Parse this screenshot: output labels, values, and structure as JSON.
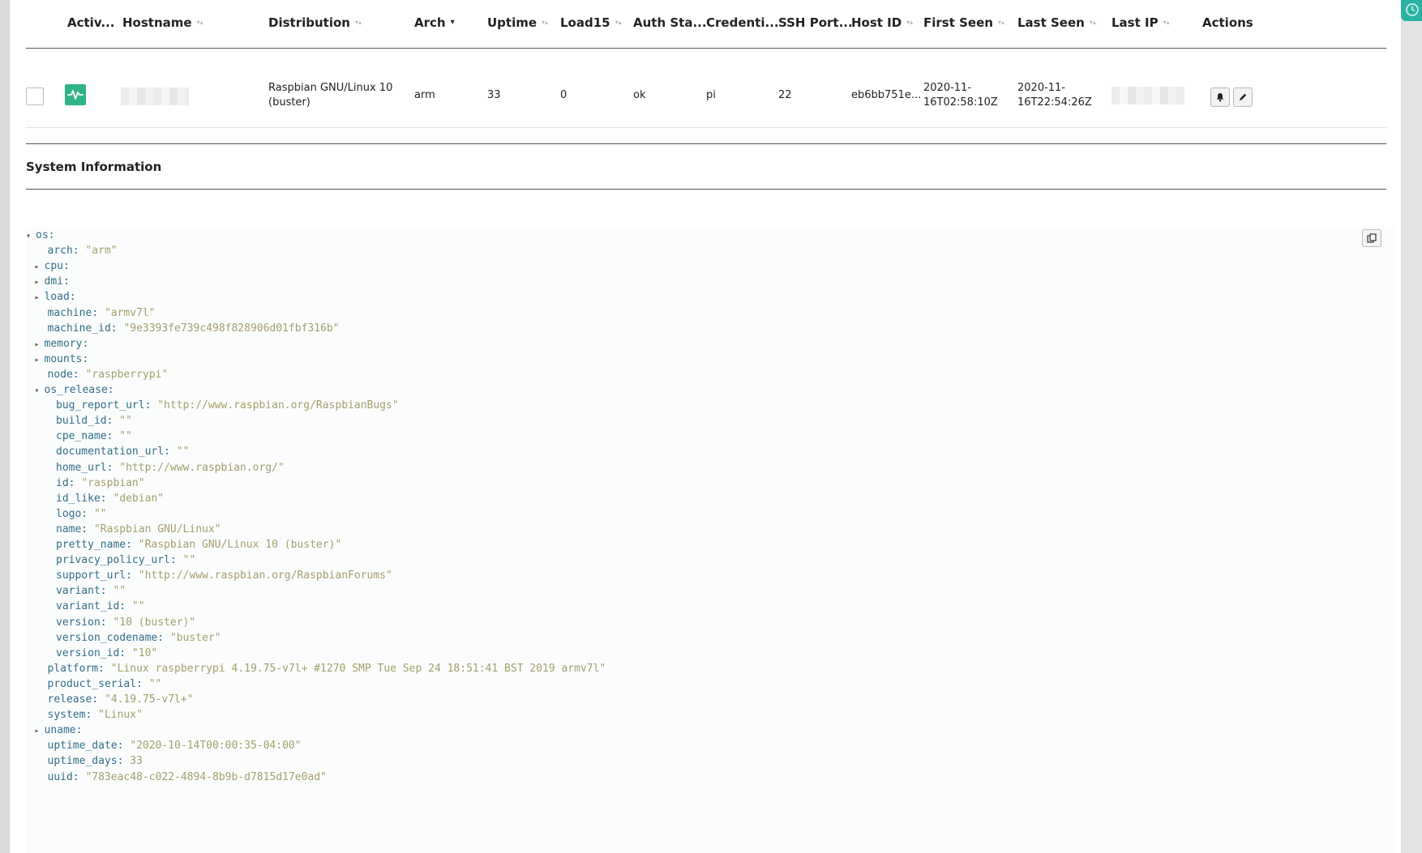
{
  "table": {
    "headers": [
      {
        "label": "Activ...",
        "sort": ""
      },
      {
        "label": "Hostname",
        "sort": "both"
      },
      {
        "label": "Distribution",
        "sort": "both"
      },
      {
        "label": "Arch",
        "sort": "down"
      },
      {
        "label": "Uptime",
        "sort": "both"
      },
      {
        "label": "Load15",
        "sort": "both"
      },
      {
        "label": "Auth Sta...",
        "sort": ""
      },
      {
        "label": "Credenti...",
        "sort": ""
      },
      {
        "label": "SSH Port...",
        "sort": ""
      },
      {
        "label": "Host ID",
        "sort": "both"
      },
      {
        "label": "First Seen",
        "sort": "both"
      },
      {
        "label": "Last Seen",
        "sort": "both"
      },
      {
        "label": "Last IP",
        "sort": "both"
      },
      {
        "label": "Actions",
        "sort": ""
      }
    ],
    "row": {
      "distribution_line1": "Raspbian GNU/Linux 10",
      "distribution_line2": "(buster)",
      "arch": "arm",
      "uptime": "33",
      "load15": "0",
      "auth_status": "ok",
      "credential": "pi",
      "ssh_port": "22",
      "host_id": "eb6bb751e...",
      "first_seen_line1": "2020-11-",
      "first_seen_line2": "16T02:58:10Z",
      "last_seen_line1": "2020-11-",
      "last_seen_line2": "16T22:54:26Z"
    }
  },
  "section": {
    "title": "System Information"
  },
  "tree": [
    {
      "indent": 0,
      "toggle": "down",
      "key": "os:",
      "value": "",
      "type": ""
    },
    {
      "indent": 1,
      "toggle": "",
      "key": "arch:",
      "value": "\"arm\"",
      "type": "str"
    },
    {
      "indent": 1,
      "toggle": "right",
      "key": "cpu:",
      "value": "",
      "type": ""
    },
    {
      "indent": 1,
      "toggle": "right",
      "key": "dmi:",
      "value": "",
      "type": ""
    },
    {
      "indent": 1,
      "toggle": "right",
      "key": "load:",
      "value": "",
      "type": ""
    },
    {
      "indent": 1,
      "toggle": "",
      "key": "machine:",
      "value": "\"armv7l\"",
      "type": "str"
    },
    {
      "indent": 1,
      "toggle": "",
      "key": "machine_id:",
      "value": "\"9e3393fe739c498f828906d01fbf316b\"",
      "type": "str"
    },
    {
      "indent": 1,
      "toggle": "right",
      "key": "memory:",
      "value": "",
      "type": ""
    },
    {
      "indent": 1,
      "toggle": "right",
      "key": "mounts:",
      "value": "",
      "type": ""
    },
    {
      "indent": 1,
      "toggle": "",
      "key": "node:",
      "value": "\"raspberrypi\"",
      "type": "str"
    },
    {
      "indent": 1,
      "toggle": "down",
      "key": "os_release:",
      "value": "",
      "type": ""
    },
    {
      "indent": 2,
      "toggle": "",
      "key": "bug_report_url:",
      "value": "\"http://www.raspbian.org/RaspbianBugs\"",
      "type": "str"
    },
    {
      "indent": 2,
      "toggle": "",
      "key": "build_id:",
      "value": "\"\"",
      "type": "str"
    },
    {
      "indent": 2,
      "toggle": "",
      "key": "cpe_name:",
      "value": "\"\"",
      "type": "str"
    },
    {
      "indent": 2,
      "toggle": "",
      "key": "documentation_url:",
      "value": "\"\"",
      "type": "str"
    },
    {
      "indent": 2,
      "toggle": "",
      "key": "home_url:",
      "value": "\"http://www.raspbian.org/\"",
      "type": "str"
    },
    {
      "indent": 2,
      "toggle": "",
      "key": "id:",
      "value": "\"raspbian\"",
      "type": "str"
    },
    {
      "indent": 2,
      "toggle": "",
      "key": "id_like:",
      "value": "\"debian\"",
      "type": "str"
    },
    {
      "indent": 2,
      "toggle": "",
      "key": "logo:",
      "value": "\"\"",
      "type": "str"
    },
    {
      "indent": 2,
      "toggle": "",
      "key": "name:",
      "value": "\"Raspbian GNU/Linux\"",
      "type": "str"
    },
    {
      "indent": 2,
      "toggle": "",
      "key": "pretty_name:",
      "value": "\"Raspbian GNU/Linux 10 (buster)\"",
      "type": "str"
    },
    {
      "indent": 2,
      "toggle": "",
      "key": "privacy_policy_url:",
      "value": "\"\"",
      "type": "str"
    },
    {
      "indent": 2,
      "toggle": "",
      "key": "support_url:",
      "value": "\"http://www.raspbian.org/RaspbianForums\"",
      "type": "str"
    },
    {
      "indent": 2,
      "toggle": "",
      "key": "variant:",
      "value": "\"\"",
      "type": "str"
    },
    {
      "indent": 2,
      "toggle": "",
      "key": "variant_id:",
      "value": "\"\"",
      "type": "str"
    },
    {
      "indent": 2,
      "toggle": "",
      "key": "version:",
      "value": "\"10 (buster)\"",
      "type": "str"
    },
    {
      "indent": 2,
      "toggle": "",
      "key": "version_codename:",
      "value": "\"buster\"",
      "type": "str"
    },
    {
      "indent": 2,
      "toggle": "",
      "key": "version_id:",
      "value": "\"10\"",
      "type": "str"
    },
    {
      "indent": 1,
      "toggle": "",
      "key": "platform:",
      "value": "\"Linux raspberrypi 4.19.75-v7l+ #1270 SMP Tue Sep 24 18:51:41 BST 2019 armv7l\"",
      "type": "str"
    },
    {
      "indent": 1,
      "toggle": "",
      "key": "product_serial:",
      "value": "\"\"",
      "type": "str"
    },
    {
      "indent": 1,
      "toggle": "",
      "key": "release:",
      "value": "\"4.19.75-v7l+\"",
      "type": "str"
    },
    {
      "indent": 1,
      "toggle": "",
      "key": "system:",
      "value": "\"Linux\"",
      "type": "str"
    },
    {
      "indent": 1,
      "toggle": "right",
      "key": "uname:",
      "value": "",
      "type": ""
    },
    {
      "indent": 1,
      "toggle": "",
      "key": "uptime_date:",
      "value": "\"2020-10-14T00:00:35-04:00\"",
      "type": "str"
    },
    {
      "indent": 1,
      "toggle": "",
      "key": "uptime_days:",
      "value": "33",
      "type": "num"
    },
    {
      "indent": 1,
      "toggle": "",
      "key": "uuid:",
      "value": "\"783eac48-c022-4894-8b9b-d7815d17e0ad\"",
      "type": "str"
    }
  ],
  "colors": {
    "activity": "#2fb488",
    "corner_widget": "#2ab3a3",
    "tree_key": "#2f6f88",
    "tree_value": "#a3a06a"
  },
  "icons": {
    "activity": "activity-pulse-icon",
    "bell": "bell-icon",
    "edit": "pencil-icon",
    "copy": "copy-icon",
    "widget": "clock-icon"
  }
}
